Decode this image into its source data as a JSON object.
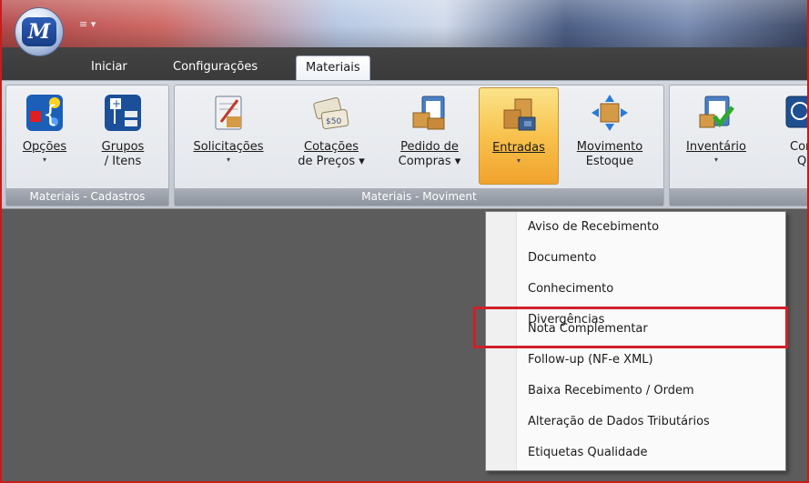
{
  "app": {
    "logo_text": "M",
    "qat_glyph": "≡ ▾"
  },
  "tabs": [
    {
      "label": "Iniciar"
    },
    {
      "label": "Configurações"
    },
    {
      "label": "Materiais",
      "active": true
    }
  ],
  "ribbon": {
    "groups": [
      {
        "label": "Materiais - Cadastros",
        "buttons": [
          {
            "line1": "Opções",
            "line2": "▾",
            "icon": "options-icon"
          },
          {
            "line1": "Grupos",
            "line2": "/ Itens",
            "icon": "groups-items-icon"
          }
        ]
      },
      {
        "label": "Materiais - Moviment",
        "buttons": [
          {
            "line1": "Solicitações",
            "line2": "▾",
            "icon": "requests-icon"
          },
          {
            "line1": "Cotações",
            "line2": "de Preços ▾",
            "icon": "quotes-icon"
          },
          {
            "line1": "Pedido de",
            "line2": "Compras ▾",
            "icon": "purchase-order-icon"
          },
          {
            "line1": "Entradas",
            "line2": "▾",
            "icon": "entries-icon",
            "active": true
          },
          {
            "line1": "Movimento",
            "line2": "Estoque",
            "icon": "stock-movement-icon"
          }
        ]
      },
      {
        "label": "",
        "buttons": [
          {
            "line1": "Inventário",
            "line2": "▾",
            "icon": "inventory-icon"
          },
          {
            "line1": "Cont",
            "line2": "Qua",
            "icon": "quality-control-icon"
          }
        ]
      }
    ]
  },
  "menu": {
    "items": [
      {
        "label": "Aviso de Recebimento"
      },
      {
        "label": "Documento"
      },
      {
        "label": "Conhecimento"
      },
      {
        "label": "Divergências"
      },
      {
        "label": "Nota Complementar",
        "highlighted": true
      },
      {
        "label": "Follow-up (NF-e XML)"
      },
      {
        "label": "Baixa Recebimento / Ordem"
      },
      {
        "label": "Alteração de Dados Tributários"
      },
      {
        "label": "Etiquetas Qualidade"
      }
    ]
  },
  "colors": {
    "highlight_border": "#d0202a",
    "active_button": "#f8c24c",
    "workspace": "#5c5c5c"
  }
}
